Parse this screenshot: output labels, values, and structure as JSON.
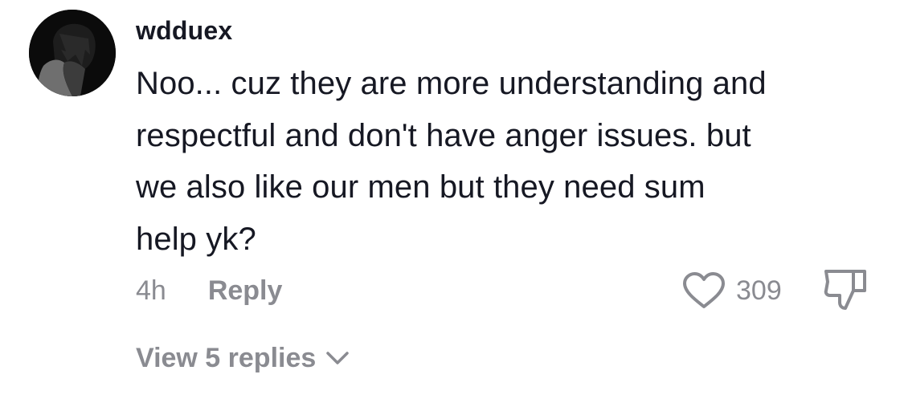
{
  "comment": {
    "username": "wdduex",
    "text_lines": [
      "Noo... cuz they are more understanding and",
      "respectful and don't have anger issues. but",
      "we also like our men but they need sum",
      "help yk?"
    ],
    "time": "4h",
    "reply_label": "Reply",
    "like_count": "309",
    "view_replies_label": "View 5 replies"
  },
  "icons": {
    "avatar": "profile-avatar-dark-anime",
    "like": "heart-outline-icon",
    "dislike": "thumbs-down-outline-icon",
    "expand": "chevron-down-icon"
  },
  "colors": {
    "primary_text": "#161823",
    "secondary_text": "#8a8b91",
    "background": "#ffffff"
  }
}
